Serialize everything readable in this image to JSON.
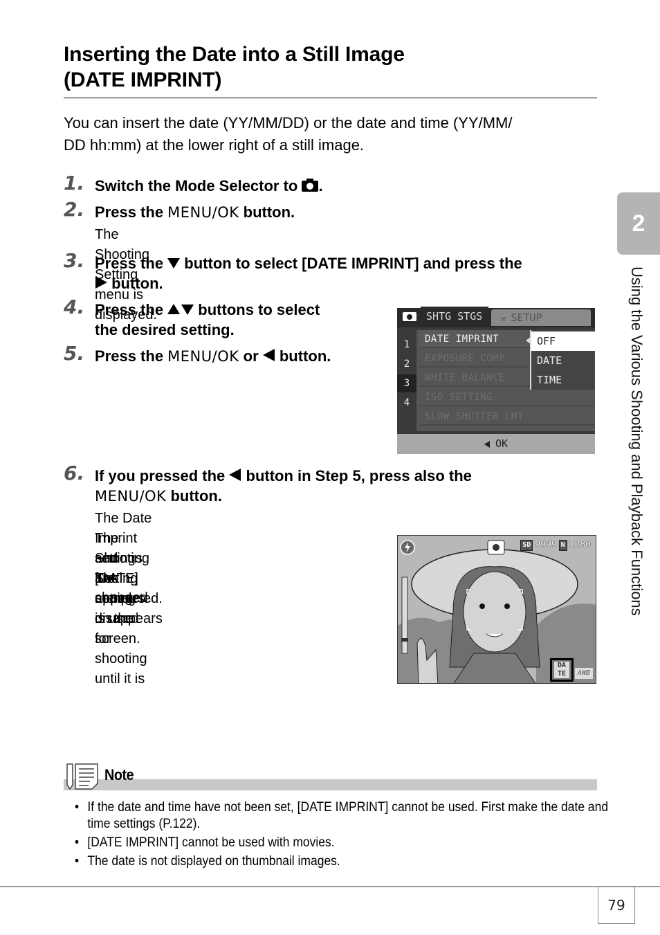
{
  "title": {
    "line1": "Inserting the Date into a Still Image",
    "line2": "(DATE IMPRINT)"
  },
  "intro": {
    "line1": "You can insert the date (YY/MM/DD) or the date and time (YY/MM/",
    "line2": "DD hh:mm) at the lower right of a still image."
  },
  "steps": [
    {
      "num": "1.",
      "parts": [
        "Switch the Mode Selector to ",
        "."
      ],
      "icon": "camera-icon"
    },
    {
      "num": "2.",
      "parts": [
        "Press the ",
        "MENU/OK",
        " button."
      ],
      "sub": "The Shooting Setting menu is displayed."
    },
    {
      "num": "3.",
      "line1": [
        "Press the ",
        " button to select [DATE IMPRINT] and press the"
      ],
      "line2": " button.",
      "icons": [
        "down-arrow-icon",
        "right-arrow-icon"
      ]
    },
    {
      "num": "4.",
      "line1": [
        "Press the ",
        " buttons to select"
      ],
      "line2": "the desired setting.",
      "icons": [
        "up-down-arrow-icon"
      ]
    },
    {
      "num": "5.",
      "parts": [
        "Press the ",
        "MENU/OK",
        " or ",
        " button."
      ],
      "icons": [
        "left-arrow-icon"
      ]
    },
    {
      "num": "6.",
      "line1": [
        "If you pressed the ",
        " button in Step 5, press also the"
      ],
      "line2": [
        "MENU/OK",
        " button."
      ],
      "icons": [
        "left-arrow-icon"
      ],
      "sub": [
        "The Date Imprint settings are completed.",
        "The Shooting Setting menu disappears",
        "and [DATE] appears on the screen.",
        "The setting is used for shooting until it is",
        "changed."
      ]
    }
  ],
  "menu_screen": {
    "tab_active": "SHTG STGS",
    "tab_inactive": "SETUP",
    "pages": [
      "1",
      "2",
      "3",
      "4"
    ],
    "active_page": "3",
    "items": [
      "DATE IMPRINT",
      "EXPOSURE COMP.",
      "WHITE BALANCE",
      "ISO SETTING",
      "SLOW SHUTTER LMT"
    ],
    "selected_item": "DATE IMPRINT",
    "options": [
      "OFF",
      "DATE",
      "TIME"
    ],
    "selected_option": "OFF",
    "bottom_label": "OK"
  },
  "live_screen": {
    "media": "SD",
    "shots_remaining": "9999",
    "quality": "N",
    "resolution": "1280",
    "date_badge_line1": "DA",
    "date_badge_line2": "TE",
    "wb_label": "AWB"
  },
  "chapter": {
    "number": "2",
    "title": "Using the Various Shooting and Playback Functions"
  },
  "note": {
    "label": "Note",
    "items": [
      "If the date and time have not been set, [DATE IMPRINT] cannot be used. First make the date and time settings (P.122).",
      "[DATE IMPRINT] cannot be used with movies.",
      "The date is not displayed on thumbnail images."
    ]
  },
  "page_number": "79"
}
